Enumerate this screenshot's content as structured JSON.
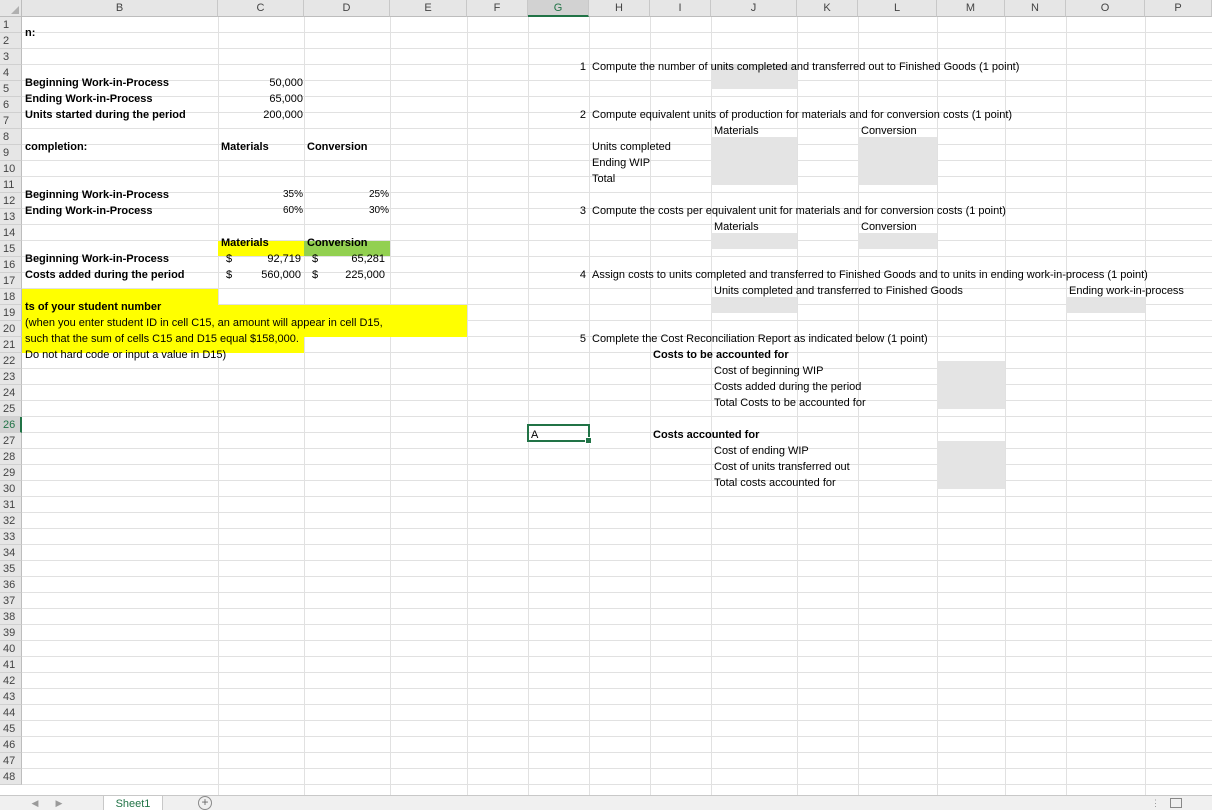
{
  "sheet": {
    "column_headers": [
      "B",
      "C",
      "D",
      "E",
      "F",
      "G",
      "H",
      "I",
      "J",
      "K",
      "L",
      "M",
      "N",
      "O",
      "P"
    ],
    "selected_column": "G",
    "row_numbers": [
      "1",
      "2",
      "3",
      "4",
      "5",
      "6",
      "7",
      "8",
      "9",
      "10",
      "11",
      "12",
      "13",
      "14",
      "15",
      "16",
      "17",
      "18",
      "19",
      "20",
      "21",
      "22",
      "23",
      "24",
      "25",
      "26",
      "27",
      "28",
      "29",
      "30",
      "31",
      "32",
      "33",
      "34",
      "35",
      "36",
      "37",
      "38",
      "39",
      "40",
      "41",
      "42",
      "43",
      "44",
      "45",
      "46",
      "47",
      "48"
    ],
    "selected_row": "26"
  },
  "cells": {
    "b1": "n:",
    "b4": "Beginning Work-in-Process",
    "c4": "50,000",
    "b5": "Ending Work-in-Process",
    "c5": "65,000",
    "b6": "Units started during the period",
    "c6": "200,000",
    "b8": "completion:",
    "c8": "Materials",
    "d8": "Conversion",
    "b11": "Beginning Work-in-Process",
    "c11": "35%",
    "d11": "25%",
    "b12": "Ending Work-in-Process",
    "c12": "60%",
    "d12": "30%",
    "c14": "Materials",
    "d14": "Conversion",
    "b15": "Beginning Work-in-Process",
    "c15_sym": "$",
    "c15": "92,719",
    "d15_sym": "$",
    "d15": "65,281",
    "b16": "Costs added during the period",
    "c16_sym": "$",
    "c16": "560,000",
    "d16_sym": "$",
    "d16": "225,000",
    "b18": "ts of your student number",
    "b19": "(when you enter student ID in cell C15, an amount will appear in cell D15,",
    "b20": " such that the sum of cells C15 and D15 equal $158,000.",
    "b21": "Do not hard code or input a value in D15)",
    "g26": "A"
  },
  "questions": {
    "q1_num": "1",
    "q1_text": "Compute the number of units completed and transferred out to Finished Goods (1 point)",
    "q2_num": "2",
    "q2_text": "Compute equivalent units of production for materials and for conversion costs (1 point)",
    "q2_materials": "Materials",
    "q2_conversion": "Conversion",
    "q2_units_completed": "Units completed",
    "q2_ending_wip": "Ending WIP",
    "q2_total": "Total",
    "q3_num": "3",
    "q3_text": "Compute the costs per equivalent unit for materials and for conversion costs (1 point)",
    "q3_materials": "Materials",
    "q3_conversion": "Conversion",
    "q4_num": "4",
    "q4_text": "Assign costs to units completed and transferred to Finished Goods and to units in ending work-in-process (1 point)",
    "q4_completed": "Units completed and transferred to Finished Goods",
    "q4_ending": "Ending work-in-process",
    "q5_num": "5",
    "q5_text": "Complete the Cost Reconciliation Report as indicated below (1 point)",
    "q5_costs_to_account": "Costs to be accounted for",
    "q5_cost_beginning": "Cost of beginning WIP",
    "q5_costs_added": "Costs added during the period",
    "q5_total_to_account": "Total Costs to be accounted for",
    "q5_costs_accounted": "Costs accounted for",
    "q5_cost_ending": "Cost of ending WIP",
    "q5_cost_transferred": "Cost of units transferred out",
    "q5_total_accounted": "Total costs accounted for"
  },
  "tabs": {
    "sheet1": "Sheet1",
    "add": "+"
  },
  "colors": {
    "highlight_yellow": "#ffff00",
    "highlight_green": "#92d050",
    "answer_gray": "#e4e4e4",
    "excel_green": "#217346"
  }
}
